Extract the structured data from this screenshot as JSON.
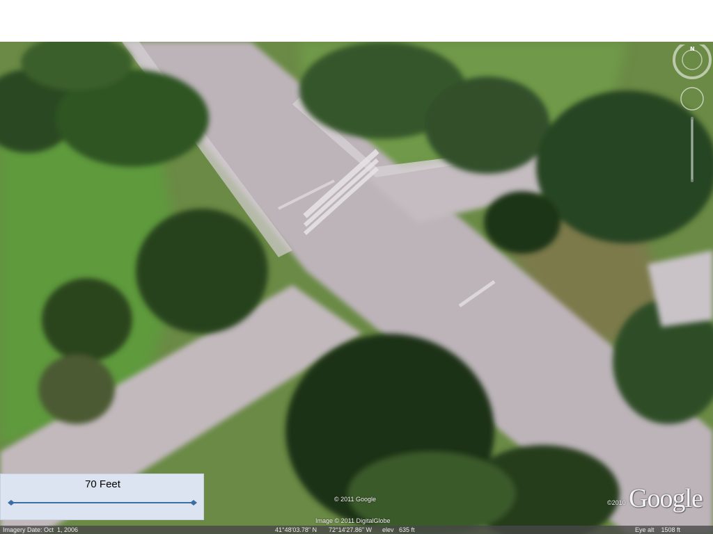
{
  "scale_legend": {
    "label": "70 Feet"
  },
  "attribution": {
    "logo": "Google",
    "logo_year": "©2010",
    "map_copyright": "© 2011 Google",
    "imagery_copyright": "Image © 2011 DigitalGlobe"
  },
  "status_bar": {
    "imagery_date": "Imagery Date: Oct  1, 2006",
    "latitude": "41°48'03.78\" N",
    "longitude": "72°14'27.86\" W",
    "elevation": "elev   635 ft",
    "eye_alt": "Eye alt    1508 ft"
  },
  "navigation": {
    "compass_label": "N"
  },
  "colors": {
    "grass": "#5e8a3a",
    "trees": "#2e4a22",
    "road": "#bdb4ba",
    "legend_bg": "#dbe4f0",
    "scale_line": "#3a6ea5"
  },
  "icons": [
    "compass-ring-icon",
    "look-joystick-icon",
    "zoom-slider-icon",
    "scale-arrow-icon"
  ]
}
